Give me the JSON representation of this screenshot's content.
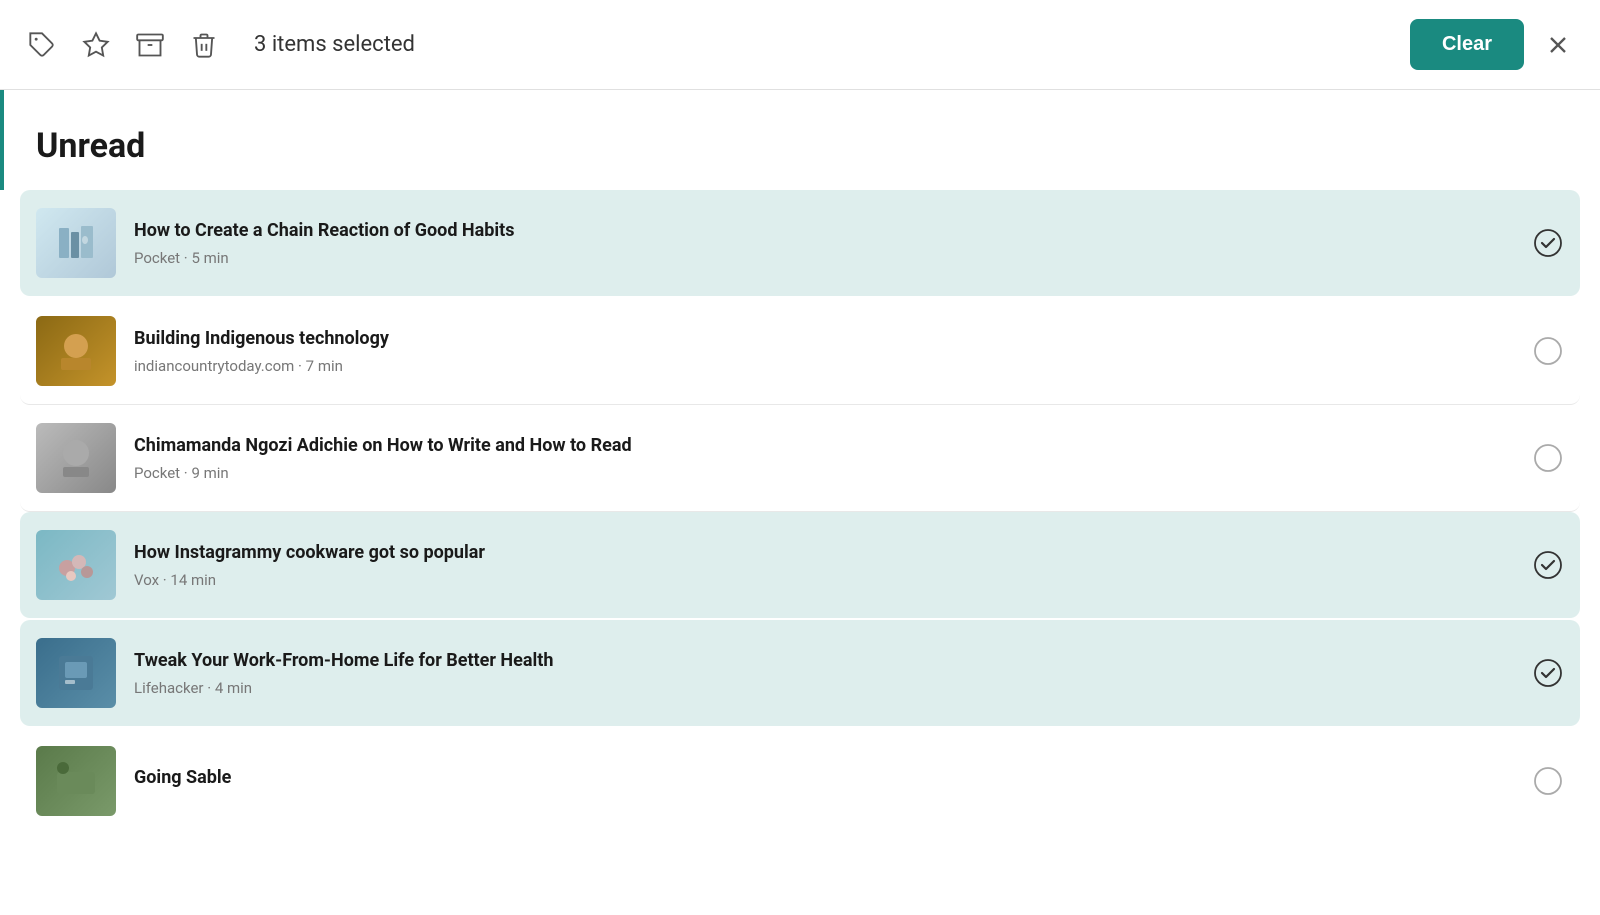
{
  "toolbar": {
    "selected_count": "3",
    "selected_label": "items selected",
    "full_label": "3 items selected",
    "clear_label": "Clear",
    "icons": [
      {
        "name": "tag-icon",
        "label": "Tag"
      },
      {
        "name": "star-icon",
        "label": "Favorite"
      },
      {
        "name": "archive-icon",
        "label": "Archive"
      },
      {
        "name": "trash-icon",
        "label": "Delete"
      }
    ]
  },
  "section": {
    "heading": "Unread"
  },
  "articles": [
    {
      "id": 1,
      "title": "How to Create a Chain Reaction of Good Habits",
      "source": "Pocket",
      "read_time": "5 min",
      "meta": "Pocket · 5 min",
      "selected": true,
      "thumb_class": "thumb-1"
    },
    {
      "id": 2,
      "title": "Building Indigenous technology",
      "source": "indiancountrytoday.com",
      "read_time": "7 min",
      "meta": "indiancountrytoday.com · 7 min",
      "selected": false,
      "thumb_class": "thumb-2"
    },
    {
      "id": 3,
      "title": "Chimamanda Ngozi Adichie on How to Write and How to Read",
      "source": "Pocket",
      "read_time": "9 min",
      "meta": "Pocket · 9 min",
      "selected": false,
      "thumb_class": "thumb-3"
    },
    {
      "id": 4,
      "title": "How Instagrammy cookware got so popular",
      "source": "Vox",
      "read_time": "14 min",
      "meta": "Vox · 14 min",
      "selected": true,
      "thumb_class": "thumb-4"
    },
    {
      "id": 5,
      "title": "Tweak Your Work-From-Home Life for Better Health",
      "source": "Lifehacker",
      "read_time": "4 min",
      "meta": "Lifehacker · 4 min",
      "selected": true,
      "thumb_class": "thumb-5"
    },
    {
      "id": 6,
      "title": "Going Sable",
      "source": "",
      "read_time": "",
      "meta": "",
      "selected": false,
      "thumb_class": "thumb-6",
      "partial": true
    }
  ]
}
